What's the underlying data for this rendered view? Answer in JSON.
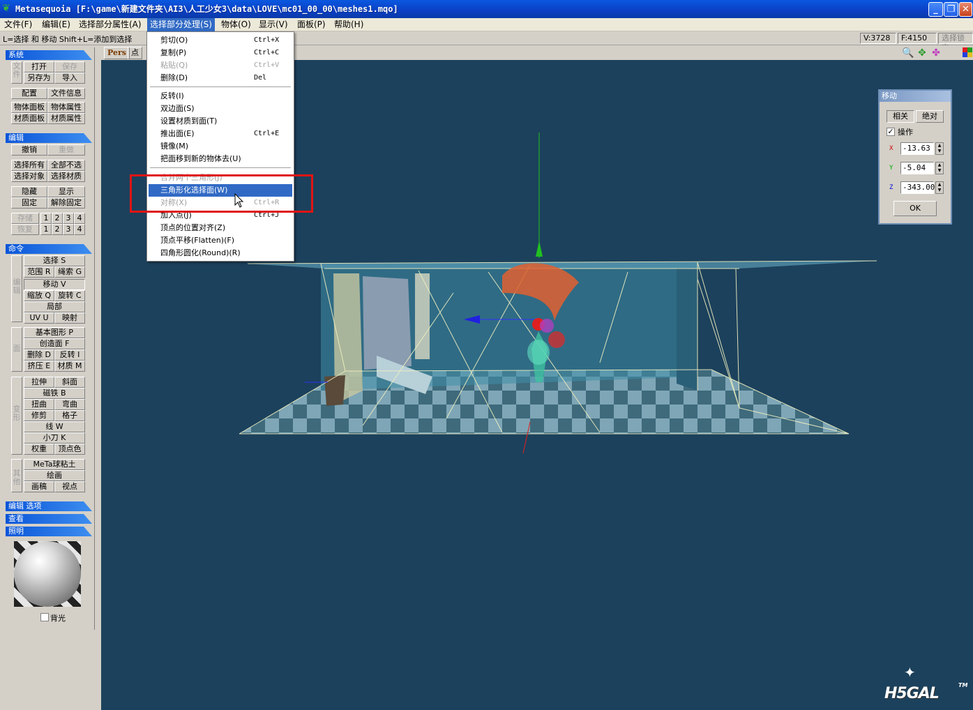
{
  "window": {
    "title": "Metasequoia [F:\\game\\新建文件夹\\AI3\\人工少女3\\data\\LOVE\\mc01_00_00\\meshes1.mqo]",
    "min_label": "_",
    "max_label": "❐",
    "close_label": "✕"
  },
  "menubar": {
    "items": [
      "文件(F)",
      "编辑(E)",
      "选择部分属性(A)",
      "选择部分处理(S)",
      "物体(O)",
      "显示(V)",
      "面板(P)",
      "帮助(H)"
    ]
  },
  "hintbar": {
    "text": "L=选择 和 移动  Shift+L=添加到选择",
    "vertex_count": "V:3728",
    "face_count": "F:4150",
    "lock_label": "选择锁定"
  },
  "viewtabs": {
    "pers": "Pers",
    "point": "点"
  },
  "dropdown": {
    "items": [
      {
        "label": "剪切(O)",
        "shortcut": "Ctrl+X",
        "state": "normal"
      },
      {
        "label": "复制(P)",
        "shortcut": "Ctrl+C",
        "state": "normal"
      },
      {
        "label": "粘贴(Q)",
        "shortcut": "Ctrl+V",
        "state": "disabled"
      },
      {
        "label": "删除(D)",
        "shortcut": "Del",
        "state": "normal"
      },
      {
        "label": "反转(I)",
        "shortcut": "",
        "state": "normal"
      },
      {
        "label": "双边面(S)",
        "shortcut": "",
        "state": "normal"
      },
      {
        "label": "设置材质到面(T)",
        "shortcut": "",
        "state": "normal"
      },
      {
        "label": "推出面(E)",
        "shortcut": "Ctrl+E",
        "state": "normal"
      },
      {
        "label": "镜像(M)",
        "shortcut": "",
        "state": "normal"
      },
      {
        "label": "把面移到新的物体去(U)",
        "shortcut": "",
        "state": "normal"
      },
      {
        "label": "合并两个三角形(J)",
        "shortcut": "",
        "state": "disabled"
      },
      {
        "label": "三角形化选择面(W)",
        "shortcut": "",
        "state": "highlight"
      },
      {
        "label": "对称(X)",
        "shortcut": "Ctrl+R",
        "state": "disabled"
      },
      {
        "label": "加入点(J)",
        "shortcut": "Ctrl+J",
        "state": "normal"
      },
      {
        "label": "顶点的位置对齐(Z)",
        "shortcut": "",
        "state": "normal"
      },
      {
        "label": "顶点平移(Flatten)(F)",
        "shortcut": "",
        "state": "normal"
      },
      {
        "label": "四角形圆化(Round)(R)",
        "shortcut": "",
        "state": "normal"
      }
    ]
  },
  "left": {
    "sections": {
      "system": "系统",
      "edit": "编辑",
      "command": "命令",
      "edit_options": "编辑 选项",
      "view": "查看",
      "lighting": "照明"
    },
    "system": {
      "side": "文件",
      "open": "打开",
      "save": "保存",
      "save_as": "另存为",
      "import": "导入",
      "config": "配置",
      "file_info": "文件信息",
      "obj_panel": "物体面板",
      "obj_prop": "物体属性",
      "mat_panel": "材质面板",
      "mat_prop": "材质属性"
    },
    "edit": {
      "undo": "撤销",
      "redo": "重做",
      "select_all": "选择所有",
      "deselect_all": "全部不选",
      "select_obj": "选择对象",
      "select_mat": "选择材质",
      "hide": "隐藏",
      "show": "显示",
      "fix": "固定",
      "unfix": "解除固定",
      "store": "存储",
      "restore": "恢复",
      "n1": "1",
      "n2": "2",
      "n3": "3",
      "n4": "4"
    },
    "cmd": {
      "side1": "编辑",
      "select": "选择 S",
      "range": "范围 R",
      "rope": "绳索 G",
      "move": "移动 V",
      "scale": "缩放 Q",
      "rotate": "旋转 C",
      "local": "局部",
      "uv": "UV U",
      "map": "映射",
      "side2": "面",
      "basic": "基本图形 P",
      "create_face": "创造面 F",
      "delete": "删除 D",
      "invert": "反转 I",
      "extrude": "挤压 E",
      "material": "材质 M",
      "side3": "变形",
      "stretch": "拉伸",
      "bevel": "斜面",
      "magnet": "磁铁 B",
      "twist": "扭曲",
      "bend": "弯曲",
      "trim": "修剪",
      "lattice": "格子",
      "line": "线 W",
      "knife": "小刀 K",
      "weight": "权重",
      "vcolor": "顶点色",
      "side4": "其他",
      "metaball": "MeTa球粘土",
      "paint": "绘画",
      "sketch": "画稿",
      "viewpoint": "视点"
    },
    "backlight": "背光"
  },
  "move_panel": {
    "title": "移动",
    "relative": "相关",
    "absolute": "绝对",
    "operate": "操作",
    "x_label": "X",
    "y_label": "Y",
    "z_label": "Z",
    "x": "-13.63",
    "y": "-5.04",
    "z": "-343.00",
    "ok": "OK"
  },
  "watermark": {
    "text": "H5GAL",
    "tm": "TM"
  }
}
